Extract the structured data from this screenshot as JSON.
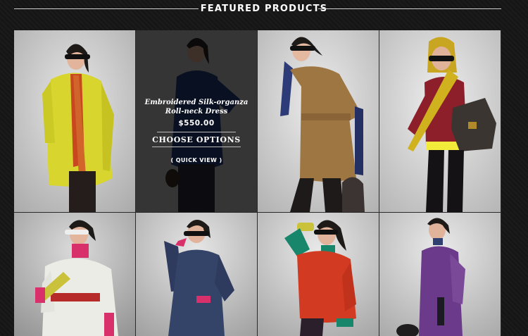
{
  "header": {
    "title": "FEATURED PRODUCTS"
  },
  "products": [
    {
      "image": "model-yellow-coat"
    },
    {
      "image": "model-navy-silk-dress",
      "name": "Embroidered Silk-organza Roll-neck Dress",
      "price": "$550.00",
      "choose_options": "CHOOSE OPTIONS",
      "quick_view": "( QUICK VIEW )"
    },
    {
      "image": "model-camel-belted-coat"
    },
    {
      "image": "model-burgundy-sweater-yellow-scarf"
    },
    {
      "image": "model-white-quilted-jacket"
    },
    {
      "image": "model-navy-quilted-coat"
    },
    {
      "image": "model-red-jacket"
    },
    {
      "image": "model-purple-jacket"
    }
  ],
  "colors": {
    "background": "#161616",
    "tile_background": "#cfcfcf",
    "overlay": "rgba(0,0,0,0.72)",
    "header_text": "#ffffff",
    "header_rule": "#cfcfcf"
  }
}
